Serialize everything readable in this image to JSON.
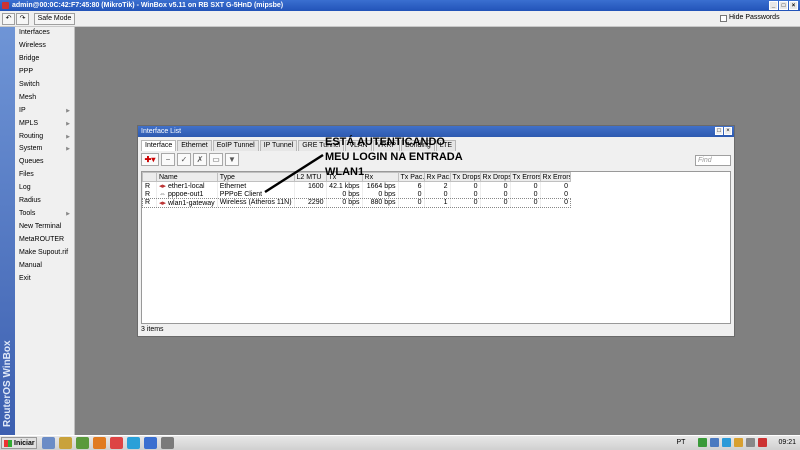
{
  "window": {
    "title": "admin@00:0C:42:F7:45:80 (MikroTik) - WinBox v5.11 on RB SXT G-5HnD (mipsbe)"
  },
  "toolbar": {
    "undo": "↶",
    "redo": "↷",
    "safe_mode": "Safe Mode",
    "hide_passwords": "Hide Passwords"
  },
  "sidebar": {
    "brand": "RouterOS WinBox",
    "items": [
      {
        "label": "Interfaces",
        "arrow": ""
      },
      {
        "label": "Wireless",
        "arrow": ""
      },
      {
        "label": "Bridge",
        "arrow": ""
      },
      {
        "label": "PPP",
        "arrow": ""
      },
      {
        "label": "Switch",
        "arrow": ""
      },
      {
        "label": "Mesh",
        "arrow": ""
      },
      {
        "label": "IP",
        "arrow": "▶"
      },
      {
        "label": "MPLS",
        "arrow": "▶"
      },
      {
        "label": "Routing",
        "arrow": "▶"
      },
      {
        "label": "System",
        "arrow": "▶"
      },
      {
        "label": "Queues",
        "arrow": ""
      },
      {
        "label": "Files",
        "arrow": ""
      },
      {
        "label": "Log",
        "arrow": ""
      },
      {
        "label": "Radius",
        "arrow": ""
      },
      {
        "label": "Tools",
        "arrow": "▶"
      },
      {
        "label": "New Terminal",
        "arrow": ""
      },
      {
        "label": "MetaROUTER",
        "arrow": ""
      },
      {
        "label": "Make Supout.rif",
        "arrow": ""
      },
      {
        "label": "Manual",
        "arrow": ""
      },
      {
        "label": "Exit",
        "arrow": ""
      }
    ]
  },
  "interface_list": {
    "title": "Interface List",
    "tabs": [
      "Interface",
      "Ethernet",
      "EoIP Tunnel",
      "IP Tunnel",
      "GRE Tunnel",
      "VLAN",
      "VRRP",
      "Bonding",
      "LTE"
    ],
    "find_placeholder": "Find",
    "columns": [
      "",
      "Name",
      "Type",
      "L2 MTU",
      "Tx",
      "Rx",
      "Tx Pac...",
      "Rx Pac...",
      "Tx Drops",
      "Rx Drops",
      "Tx Errors",
      "Rx Errors"
    ],
    "rows": [
      {
        "flag": "R",
        "name": "ether1-local",
        "type": "Ethernet",
        "l2mtu": "1600",
        "tx": "42.1 kbps",
        "rx": "1664 bps",
        "txp": "6",
        "rxp": "2",
        "txd": "0",
        "rxd": "0",
        "txe": "0",
        "rxe": "0"
      },
      {
        "flag": "R",
        "name": "pppoe-out1",
        "type": "PPPoE Client",
        "l2mtu": "",
        "tx": "0 bps",
        "rx": "0 bps",
        "txp": "0",
        "rxp": "0",
        "txd": "0",
        "rxd": "0",
        "txe": "0",
        "rxe": "0"
      },
      {
        "flag": "R",
        "name": "wlan1-gateway",
        "type": "Wireless (Atheros 11N)",
        "l2mtu": "2290",
        "tx": "0 bps",
        "rx": "880 bps",
        "txp": "0",
        "rxp": "1",
        "txd": "0",
        "rxd": "0",
        "txe": "0",
        "rxe": "0"
      }
    ],
    "status": "3 items"
  },
  "annotation": {
    "line1": "ESTÁ AUTENTICANDO",
    "line2": "MEU LOGIN NA ENTRADA",
    "line3": "WLAN1"
  },
  "taskbar": {
    "start": "Iniciar",
    "language": "PT",
    "clock": "09:21"
  }
}
